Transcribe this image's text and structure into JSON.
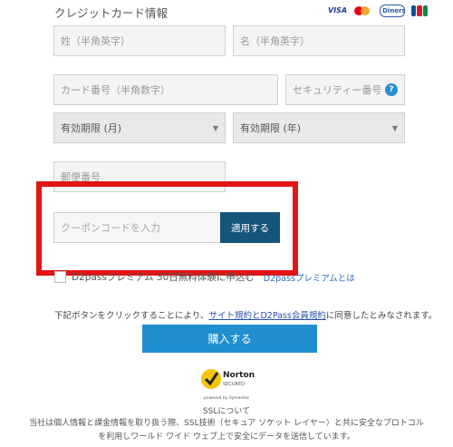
{
  "section_title": "クレジットカード情報",
  "card_brands": {
    "visa": "VISA",
    "diners": "Diners",
    "jcb": "JCB"
  },
  "fields": {
    "last_name_placeholder": "姓（半角英字）",
    "first_name_placeholder": "名（半角英字）",
    "card_number_placeholder": "カード番号（半角数字）",
    "security_code_placeholder": "セキュリティー番号",
    "help_icon": "?",
    "expiry_month": "有効期限 (月)",
    "expiry_year": "有効期限 (年)",
    "postal_code_placeholder": "郵便番号"
  },
  "coupon": {
    "placeholder": "クーポンコードを入力",
    "apply_label": "適用する"
  },
  "premium": {
    "label": "D2passプレミアム 30日無料体験に申込む",
    "link": "D2passプレミアムとは"
  },
  "agreement": {
    "prefix": "下記ボタンをクリックすることにより、",
    "link1": "サイト規約",
    "middle": "とD2Pass会員規約",
    "link2": "に同意したとみなされます。"
  },
  "buy_button": "購入する",
  "norton": {
    "name": "Norton",
    "sub": "SECURED",
    "powered": "powered by Symantec"
  },
  "ssl": {
    "title": "SSLについて",
    "text": "当社は個人情報と課金情報を取り扱う際、SSL技術（セキュア ソケット レイヤー）と共に安全なプロトコルを利用しワールド ワイド ウェブ上で安全にデータを送信しています。"
  },
  "colors": {
    "accent": "#1f8fcf",
    "apply": "#15557a",
    "highlight": "#e21414"
  }
}
